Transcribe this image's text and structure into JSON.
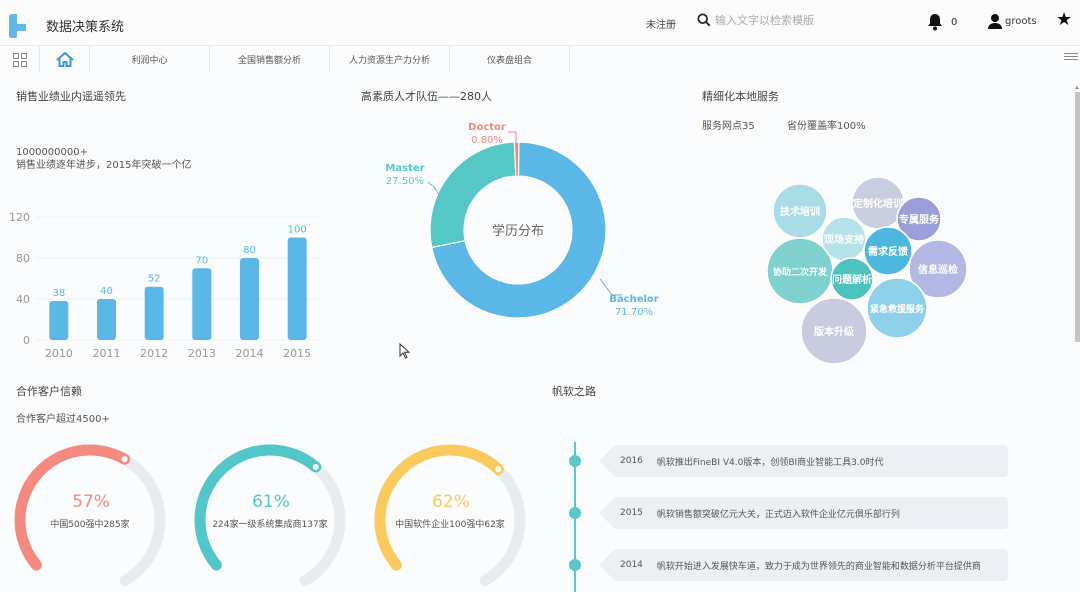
{
  "header": {
    "app_title": "数据决策系统",
    "unregistered": "未注册",
    "search_placeholder": "输入文字以检索模版",
    "notification_count": "0",
    "username": "groots"
  },
  "tabs": [
    {
      "label": "利润中心"
    },
    {
      "label": "全国销售额分析"
    },
    {
      "label": "人力资源生产力分析"
    },
    {
      "label": "仪表盘组合"
    }
  ],
  "sales": {
    "title": "销售业绩业内遥遥领先",
    "big_number": "1000000000+",
    "subtitle": "销售业绩逐年进步，2015年突破一个亿"
  },
  "talent": {
    "title": "高素质人才队伍——280人"
  },
  "service": {
    "title": "精细化本地服务",
    "stat1": "服务网点35",
    "stat2": "省份覆盖率100%",
    "bubbles": [
      {
        "label": "技术培训",
        "color": "#a8dde8"
      },
      {
        "label": "定制化培训",
        "color": "#c8cde0"
      },
      {
        "label": "专属服务",
        "color": "#9b9ed8"
      },
      {
        "label": "现场支持",
        "color": "#b6e2ea"
      },
      {
        "label": "需求反馈",
        "color": "#4fb6e0"
      },
      {
        "label": "信息巡检",
        "color": "#b4b8e4"
      },
      {
        "label": "协助二次开发",
        "color": "#7ed1cf"
      },
      {
        "label": "问题解析",
        "color": "#4cc4bd"
      },
      {
        "label": "紧急救援服务",
        "color": "#8ecfea"
      },
      {
        "label": "版本升级",
        "color": "#c9cce0"
      }
    ]
  },
  "customers": {
    "title": "合作客户信赖",
    "subtitle": "合作客户超过4500+",
    "gauges": [
      {
        "value": 57,
        "label_pct": "57%",
        "caption": "中国500强中285家",
        "color": "#f48a80"
      },
      {
        "value": 61,
        "label_pct": "61%",
        "caption": "224家一级系统集成商137家",
        "color": "#52c6c8"
      },
      {
        "value": 62,
        "label_pct": "62%",
        "caption": "中国软件企业100强中62家",
        "color": "#fbc95c"
      }
    ]
  },
  "timeline": {
    "title": "帆软之路",
    "items": [
      {
        "year": "2016",
        "text": "帆软推出FineBI V4.0版本，创领BI商业智能工具3.0时代"
      },
      {
        "year": "2015",
        "text": "帆软销售额突破亿元大关，正式迈入软件企业亿元俱乐部行列"
      },
      {
        "year": "2014",
        "text": "帆软开始进入发展快车道，致力于成为世界领先的商业智能和数据分析平台提供商"
      }
    ]
  },
  "chart_data": [
    {
      "type": "bar",
      "title": "",
      "categories": [
        "2010",
        "2011",
        "2012",
        "2013",
        "2014",
        "2015"
      ],
      "values": [
        38,
        40,
        52,
        70,
        80,
        100
      ],
      "yticks": [
        "0",
        "40",
        "80",
        "120"
      ],
      "ylim": [
        0,
        120
      ],
      "xlabel": "",
      "ylabel": "",
      "grid": true,
      "color": "#5bb8e6"
    },
    {
      "type": "pie",
      "title": "学历分布",
      "donut": true,
      "slices": [
        {
          "name": "Bachelor",
          "value": 71.7,
          "label": "71.70%",
          "color": "#5bb8e6"
        },
        {
          "name": "Master",
          "value": 27.5,
          "label": "27.50%",
          "color": "#55c8c6"
        },
        {
          "name": "Doctor",
          "value": 0.8,
          "label": "0.80%",
          "color": "#f08a80"
        }
      ]
    }
  ]
}
